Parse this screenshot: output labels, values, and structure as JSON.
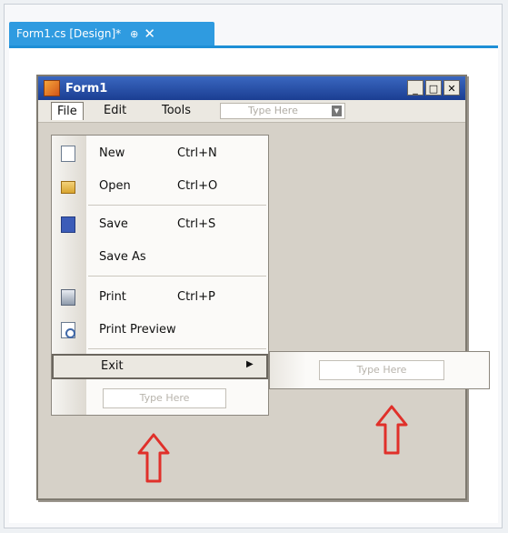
{
  "tab": {
    "title": "Form1.cs [Design]*",
    "pin_glyph": "⊕",
    "close_glyph": "✕"
  },
  "form": {
    "title": "Form1",
    "minimize": "_",
    "maximize": "□",
    "close": "✕"
  },
  "menubar": {
    "items": [
      {
        "label": "File",
        "accel": "F"
      },
      {
        "label": "Edit",
        "accel": "E"
      },
      {
        "label": "Tools",
        "accel": "T"
      }
    ],
    "type_here": "Type Here"
  },
  "file_menu": {
    "items": [
      {
        "label": "New",
        "shortcut": "Ctrl+N",
        "icon": "new-document-icon"
      },
      {
        "label": "Open",
        "shortcut": "Ctrl+O",
        "icon": "open-folder-icon"
      },
      {
        "label": "Save",
        "shortcut": "Ctrl+S",
        "icon": "save-disk-icon"
      },
      {
        "label": "Save As",
        "shortcut": "",
        "icon": ""
      },
      {
        "label": "Print",
        "shortcut": "Ctrl+P",
        "icon": "printer-icon"
      },
      {
        "label": "Print Preview",
        "shortcut": "",
        "icon": "print-preview-icon"
      },
      {
        "label": "Exit",
        "shortcut": "",
        "icon": ""
      }
    ],
    "submenu_arrow": "▶",
    "type_here": "Type Here"
  },
  "submenu": {
    "type_here": "Type Here"
  },
  "annotation_color": "#e0302a"
}
